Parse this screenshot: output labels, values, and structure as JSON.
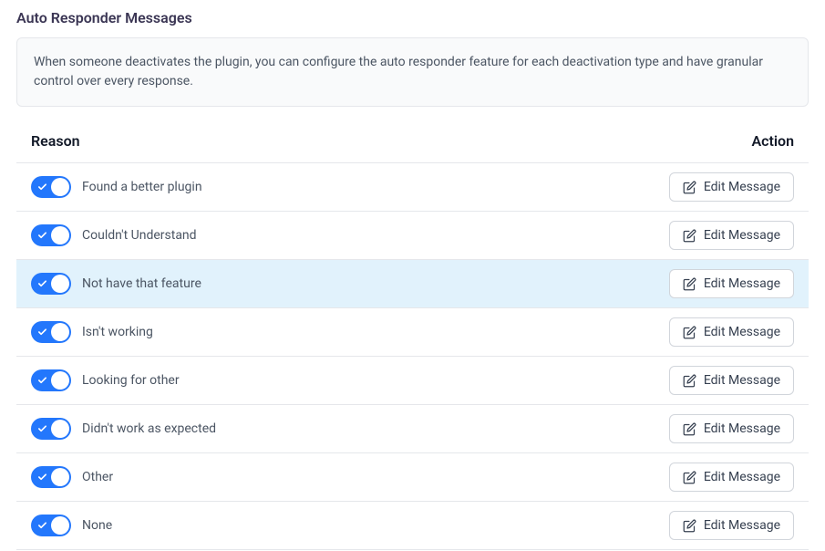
{
  "pageTitle": "Auto Responder Messages",
  "infoText": "When someone deactivates the plugin, you can configure the auto responder feature for each deactivation type and have granular control over every response.",
  "columns": {
    "reason": "Reason",
    "action": "Action"
  },
  "editButtonLabel": "Edit Message",
  "reasons": [
    {
      "label": "Found a better plugin",
      "enabled": true,
      "highlight": false
    },
    {
      "label": "Couldn't Understand",
      "enabled": true,
      "highlight": false
    },
    {
      "label": "Not have that feature",
      "enabled": true,
      "highlight": true
    },
    {
      "label": "Isn't working",
      "enabled": true,
      "highlight": false
    },
    {
      "label": "Looking for other",
      "enabled": true,
      "highlight": false
    },
    {
      "label": "Didn't work as expected",
      "enabled": true,
      "highlight": false
    },
    {
      "label": "Other",
      "enabled": true,
      "highlight": false
    },
    {
      "label": "None",
      "enabled": true,
      "highlight": false
    }
  ]
}
